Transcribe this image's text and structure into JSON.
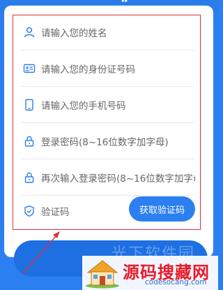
{
  "header": {
    "quote_glyph": "“"
  },
  "form": {
    "fields": [
      {
        "icon": "user-icon",
        "placeholder": "请输入您的姓名"
      },
      {
        "icon": "id-card-icon",
        "placeholder": "请输入您的身份证号码"
      },
      {
        "icon": "phone-icon",
        "placeholder": "请输入您的手机号码"
      },
      {
        "icon": "lock-icon",
        "placeholder": "登录密码(8~16位数字加字母)"
      },
      {
        "icon": "lock-icon",
        "placeholder": "再次输入登录密码(8~16位数字加字母)"
      },
      {
        "icon": "shield-icon",
        "placeholder": "验证码"
      }
    ],
    "get_code_label": "获取验证码"
  },
  "watermark": {
    "bg_text": "光下软件园"
  },
  "logo": {
    "title": "源码搜藏网",
    "url": "codesocang.com"
  },
  "colors": {
    "accent": "#2c7ff0",
    "highlight_border": "#d6323d",
    "logo_red": "#e81b2a"
  }
}
